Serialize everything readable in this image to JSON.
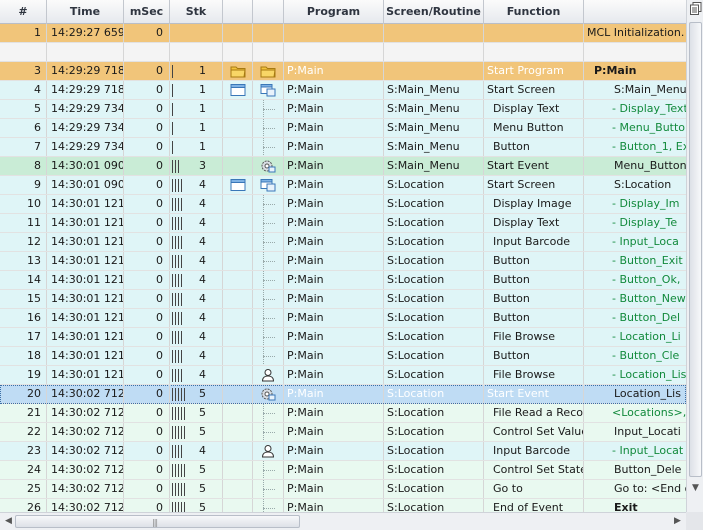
{
  "columns": [
    "#",
    "Time",
    "mSec",
    "Stk",
    "",
    "",
    "Program",
    "Screen/Routine",
    "Function",
    ""
  ],
  "rows": [
    {
      "num": "1",
      "time": "14:29:27 659",
      "ms": "0",
      "stk": "",
      "bars": 0,
      "i1": "",
      "i2": "",
      "prog": "",
      "scr": "",
      "func": "",
      "rest": "MCL Initialization.",
      "style": "orange"
    },
    {
      "num": "",
      "time": "",
      "ms": "",
      "stk": "",
      "bars": 0,
      "i1": "",
      "i2": "",
      "prog": "",
      "scr": "",
      "func": "",
      "rest": "",
      "style": "blank"
    },
    {
      "num": "3",
      "time": "14:29:29 718",
      "ms": "0",
      "stk": "1",
      "bars": 1,
      "i1": "folder",
      "i2": "folder",
      "prog": "P:Main",
      "scr": "",
      "func": "Start Program",
      "rest": "P:Main",
      "style": "orange",
      "textclass": "white",
      "restclass": "bold"
    },
    {
      "num": "4",
      "time": "14:29:29 718",
      "ms": "0",
      "stk": "1",
      "bars": 1,
      "i1": "window",
      "i2": "window-tree",
      "prog": "P:Main",
      "scr": "S:Main_Menu",
      "func": "Start Screen",
      "rest": "S:Main_Menu",
      "style": "cyan"
    },
    {
      "num": "5",
      "time": "14:29:29 734",
      "ms": "0",
      "stk": "1",
      "bars": 1,
      "i1": "",
      "i2": "tree",
      "prog": "P:Main",
      "scr": "S:Main_Menu",
      "func": "Display Text",
      "rest": "- Display_Text",
      "style": "cyan",
      "restclass": "green"
    },
    {
      "num": "6",
      "time": "14:29:29 734",
      "ms": "0",
      "stk": "1",
      "bars": 1,
      "i1": "",
      "i2": "tree",
      "prog": "P:Main",
      "scr": "S:Main_Menu",
      "func": "Menu Button",
      "rest": "- Menu_Butto",
      "style": "cyan",
      "restclass": "green"
    },
    {
      "num": "7",
      "time": "14:29:29 734",
      "ms": "0",
      "stk": "1",
      "bars": 1,
      "i1": "",
      "i2": "tree",
      "prog": "P:Main",
      "scr": "S:Main_Menu",
      "func": "Button",
      "rest": "- Button_1, Exi",
      "style": "cyan",
      "restclass": "green"
    },
    {
      "num": "8",
      "time": "14:30:01 090",
      "ms": "0",
      "stk": "3",
      "bars": 3,
      "i1": "",
      "i2": "gear",
      "prog": "P:Main",
      "scr": "S:Main_Menu",
      "func": "Start Event",
      "rest": "Menu_Button",
      "style": "green"
    },
    {
      "num": "9",
      "time": "14:30:01 090",
      "ms": "0",
      "stk": "4",
      "bars": 4,
      "i1": "window",
      "i2": "window-tree",
      "prog": "P:Main",
      "scr": "S:Location",
      "func": "Start Screen",
      "rest": "S:Location",
      "style": "cyan"
    },
    {
      "num": "10",
      "time": "14:30:01 121",
      "ms": "0",
      "stk": "4",
      "bars": 4,
      "i1": "",
      "i2": "tree",
      "prog": "P:Main",
      "scr": "S:Location",
      "func": "Display Image",
      "rest": "- Display_Im",
      "style": "cyan",
      "restclass": "green"
    },
    {
      "num": "11",
      "time": "14:30:01 121",
      "ms": "0",
      "stk": "4",
      "bars": 4,
      "i1": "",
      "i2": "tree",
      "prog": "P:Main",
      "scr": "S:Location",
      "func": "Display Text",
      "rest": "- Display_Te",
      "style": "cyan",
      "restclass": "green"
    },
    {
      "num": "12",
      "time": "14:30:01 121",
      "ms": "0",
      "stk": "4",
      "bars": 4,
      "i1": "",
      "i2": "tree",
      "prog": "P:Main",
      "scr": "S:Location",
      "func": "Input Barcode",
      "rest": "- Input_Loca",
      "style": "cyan",
      "restclass": "green"
    },
    {
      "num": "13",
      "time": "14:30:01 121",
      "ms": "0",
      "stk": "4",
      "bars": 4,
      "i1": "",
      "i2": "tree",
      "prog": "P:Main",
      "scr": "S:Location",
      "func": "Button",
      "rest": "- Button_Exit",
      "style": "cyan",
      "restclass": "green"
    },
    {
      "num": "14",
      "time": "14:30:01 121",
      "ms": "0",
      "stk": "4",
      "bars": 4,
      "i1": "",
      "i2": "tree",
      "prog": "P:Main",
      "scr": "S:Location",
      "func": "Button",
      "rest": "- Button_Ok,",
      "style": "cyan",
      "restclass": "green"
    },
    {
      "num": "15",
      "time": "14:30:01 121",
      "ms": "0",
      "stk": "4",
      "bars": 4,
      "i1": "",
      "i2": "tree",
      "prog": "P:Main",
      "scr": "S:Location",
      "func": "Button",
      "rest": "- Button_New",
      "style": "cyan",
      "restclass": "green"
    },
    {
      "num": "16",
      "time": "14:30:01 121",
      "ms": "0",
      "stk": "4",
      "bars": 4,
      "i1": "",
      "i2": "tree",
      "prog": "P:Main",
      "scr": "S:Location",
      "func": "Button",
      "rest": "- Button_Del",
      "style": "cyan",
      "restclass": "green"
    },
    {
      "num": "17",
      "time": "14:30:01 121",
      "ms": "0",
      "stk": "4",
      "bars": 4,
      "i1": "",
      "i2": "tree",
      "prog": "P:Main",
      "scr": "S:Location",
      "func": "File Browse",
      "rest": "- Location_Li",
      "style": "cyan",
      "restclass": "green"
    },
    {
      "num": "18",
      "time": "14:30:01 121",
      "ms": "0",
      "stk": "4",
      "bars": 4,
      "i1": "",
      "i2": "tree",
      "prog": "P:Main",
      "scr": "S:Location",
      "func": "Button",
      "rest": "- Button_Cle",
      "style": "cyan",
      "restclass": "green"
    },
    {
      "num": "19",
      "time": "14:30:01 121",
      "ms": "0",
      "stk": "4",
      "bars": 4,
      "i1": "",
      "i2": "person",
      "prog": "P:Main",
      "scr": "S:Location",
      "func": "File Browse",
      "rest": "- Location_Lis",
      "style": "cyan",
      "restclass": "green"
    },
    {
      "num": "20",
      "time": "14:30:02 712",
      "ms": "0",
      "stk": "5",
      "bars": 5,
      "i1": "",
      "i2": "gear",
      "prog": "P:Main",
      "scr": "S:Location",
      "func": "Start Event",
      "rest": "Location_Lis",
      "style": "sel",
      "textclass": "white"
    },
    {
      "num": "21",
      "time": "14:30:02 712",
      "ms": "0",
      "stk": "5",
      "bars": 5,
      "i1": "",
      "i2": "tree",
      "prog": "P:Main",
      "scr": "S:Location",
      "func": "File Read a Reco",
      "rest": "<Locations>,",
      "style": "mint",
      "restclass": "green"
    },
    {
      "num": "22",
      "time": "14:30:02 712",
      "ms": "0",
      "stk": "5",
      "bars": 5,
      "i1": "",
      "i2": "tree",
      "prog": "P:Main",
      "scr": "S:Location",
      "func": "Control Set Value",
      "rest": "Input_Locati",
      "style": "mint"
    },
    {
      "num": "23",
      "time": "14:30:02 712",
      "ms": "0",
      "stk": "4",
      "bars": 4,
      "i1": "",
      "i2": "person",
      "prog": "P:Main",
      "scr": "S:Location",
      "func": "Input Barcode",
      "rest": "- Input_Locat",
      "style": "cyan",
      "restclass": "green"
    },
    {
      "num": "24",
      "time": "14:30:02 712",
      "ms": "0",
      "stk": "5",
      "bars": 5,
      "i1": "",
      "i2": "tree-arrow",
      "prog": "P:Main",
      "scr": "S:Location",
      "func": "Control Set State",
      "rest": "Button_Dele",
      "style": "mint"
    },
    {
      "num": "25",
      "time": "14:30:02 712",
      "ms": "0",
      "stk": "5",
      "bars": 5,
      "i1": "",
      "i2": "tree",
      "prog": "P:Main",
      "scr": "S:Location",
      "func": "Go to",
      "rest": "Go to: <End o",
      "style": "mint"
    },
    {
      "num": "26",
      "time": "14:30:02 712",
      "ms": "0",
      "stk": "5",
      "bars": 5,
      "i1": "",
      "i2": "tree",
      "prog": "P:Main",
      "scr": "S:Location",
      "func": "End of Event",
      "rest": "Exit",
      "style": "mint",
      "restclass": "bold"
    }
  ]
}
